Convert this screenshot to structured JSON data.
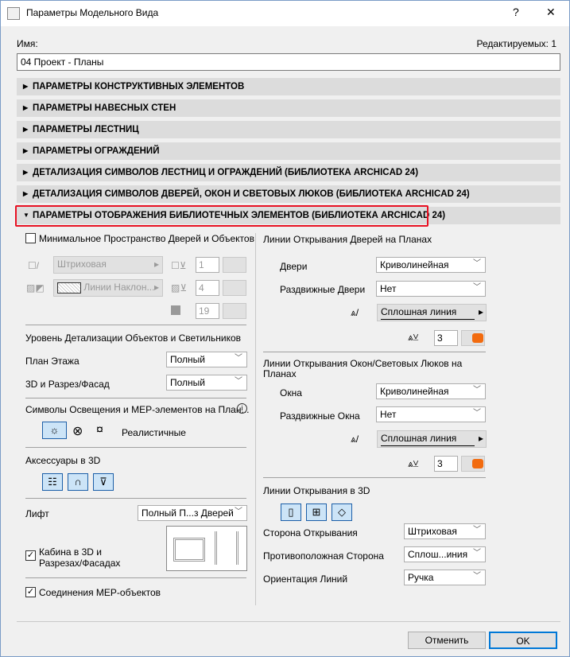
{
  "window": {
    "title": "Параметры Модельного Вида",
    "help": "?",
    "close": "✕"
  },
  "name_label": "Имя:",
  "editing": "Редактируемых: 1",
  "name_value": "04 Проект - Планы",
  "sections": [
    "ПАРАМЕТРЫ КОНСТРУКТИВНЫХ ЭЛЕМЕНТОВ",
    "ПАРАМЕТРЫ НАВЕСНЫХ СТЕН",
    "ПАРАМЕТРЫ ЛЕСТНИЦ",
    "ПАРАМЕТРЫ ОГРАЖДЕНИЙ",
    "ДЕТАЛИЗАЦИЯ СИМВОЛОВ ЛЕСТНИЦ И ОГРАЖДЕНИЙ (БИБЛИОТЕКА ARCHICAD 24)",
    "ДЕТАЛИЗАЦИЯ СИМВОЛОВ ДВЕРЕЙ, ОКОН И СВЕТОВЫХ ЛЮКОВ (БИБЛИОТЕКА ARCHICAD 24)",
    "ПАРАМЕТРЫ ОТОБРАЖЕНИЯ БИБЛИОТЕЧНЫХ ЭЛЕМЕНТОВ (БИБЛИОТЕКА ARCHICAD 24)"
  ],
  "left": {
    "min_space": "Минимальное Пространство Дверей и Объектов",
    "line_type": "Штриховая",
    "fill_type": "Линии Наклон...",
    "pen1": "1",
    "pen2": "4",
    "pen3": "19",
    "detail_title": "Уровень Детализации Объектов и Светильников",
    "floor_plan_label": "План Этажа",
    "floor_plan_value": "Полный",
    "section_label": "3D и Разрез/Фасад",
    "section_value": "Полный",
    "mep_title": "Символы Освещения и MEP-элементов на План...",
    "mep_mode": "Реалистичные",
    "acc_title": "Аксессуары в 3D",
    "lift_label": "Лифт",
    "lift_value": "Полный П...з Дверей",
    "cabin": "Кабина в 3D и Разрезах/Фасадах",
    "mep_conn": "Соединения MEP-объектов"
  },
  "right": {
    "door_title": "Линии Открывания Дверей на Планах",
    "doors_label": "Двери",
    "doors_value": "Криволинейная",
    "sliding_doors_label": "Раздвижные Двери",
    "sliding_doors_value": "Нет",
    "door_line": "Сплошная линия",
    "door_pen": "3",
    "win_title": "Линии Открывания Окон/Световых Люков на Планах",
    "windows_label": "Окна",
    "windows_value": "Криволинейная",
    "sliding_win_label": "Раздвижные Окна",
    "sliding_win_value": "Нет",
    "win_line": "Сплошная линия",
    "win_pen": "3",
    "open3d_title": "Линии Открывания в 3D",
    "side_label": "Сторона Открывания",
    "side_value": "Штриховая",
    "opp_label": "Противоположная Сторона",
    "opp_value": "Сплош...иния",
    "orient_label": "Ориентация Линий",
    "orient_value": "Ручка"
  },
  "buttons": {
    "cancel": "Отменить",
    "ok": "OK"
  },
  "colors": {
    "pen_orange": "#f26b0f",
    "highlight": "#e81123",
    "selected": "#cce4f7"
  }
}
